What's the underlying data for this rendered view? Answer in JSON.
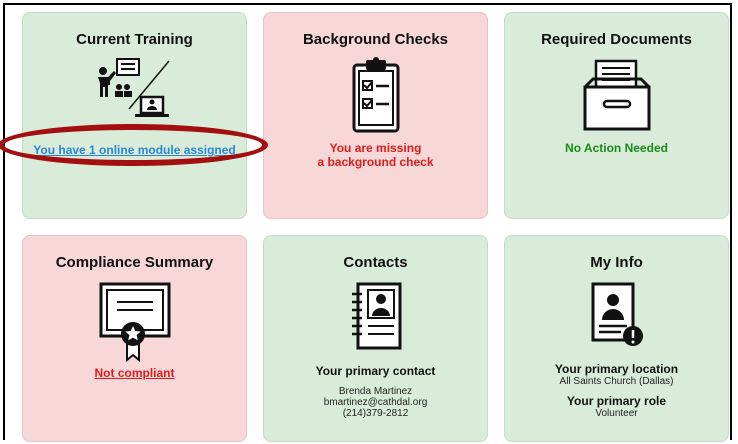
{
  "cards": {
    "training": {
      "title": "Current Training",
      "link": "You have 1 online module assigned",
      "icon": "classroom-to-online-icon"
    },
    "background": {
      "title": "Background Checks",
      "status_line1": "You are missing",
      "status_line2": "a background check",
      "icon": "clipboard-checklist-icon"
    },
    "documents": {
      "title": "Required Documents",
      "status": "No Action Needed",
      "icon": "file-drawer-icon"
    },
    "compliance": {
      "title": "Compliance Summary",
      "link": "Not compliant",
      "icon": "certificate-icon"
    },
    "contacts": {
      "title": "Contacts",
      "heading": "Your primary contact",
      "name": "Brenda Martinez",
      "email": "bmartinez@cathdal.org",
      "phone": "(214)379-2812",
      "icon": "contact-book-icon"
    },
    "myinfo": {
      "title": "My Info",
      "location_heading": "Your primary location",
      "location": "All Saints Church (Dallas)",
      "role_heading": "Your primary role",
      "role": "Volunteer",
      "icon": "profile-alert-icon"
    }
  },
  "colors": {
    "card_green": "#d9ecd9",
    "card_pink": "#f7d7d7",
    "link_blue": "#2a86d6",
    "alert_red": "#e01b1b",
    "ok_green": "#1a8a1a",
    "annotation_oval": "#a30f10"
  }
}
